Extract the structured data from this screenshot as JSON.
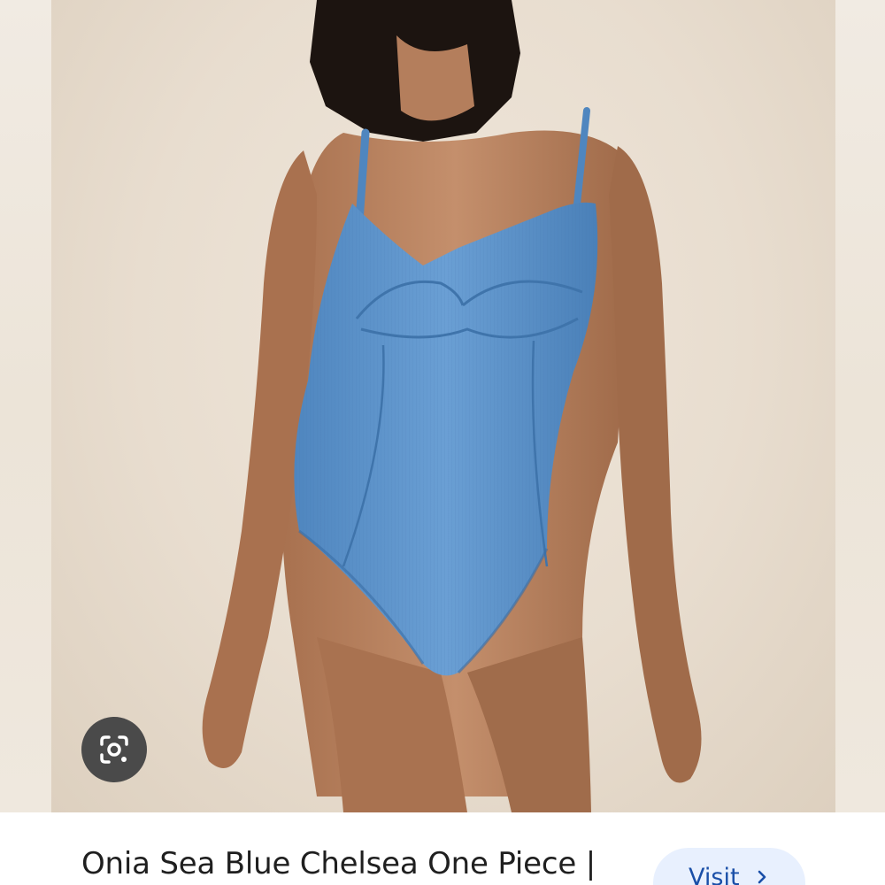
{
  "product": {
    "title": "Onia Sea Blue Chelsea One Piece |",
    "image_alt": "Model wearing sea blue ribbed underwire one-piece swimsuit"
  },
  "actions": {
    "visit_label": "Visit",
    "lens_icon": "google-lens-icon",
    "visit_icon": "chevron-right-icon"
  },
  "colors": {
    "swimsuit": "#5b93cc",
    "background": "#ebe1d4",
    "skin": "#b98563",
    "hair": "#1c1410",
    "visit_bg": "#e8f0fe",
    "visit_text": "#1a4fa8"
  }
}
